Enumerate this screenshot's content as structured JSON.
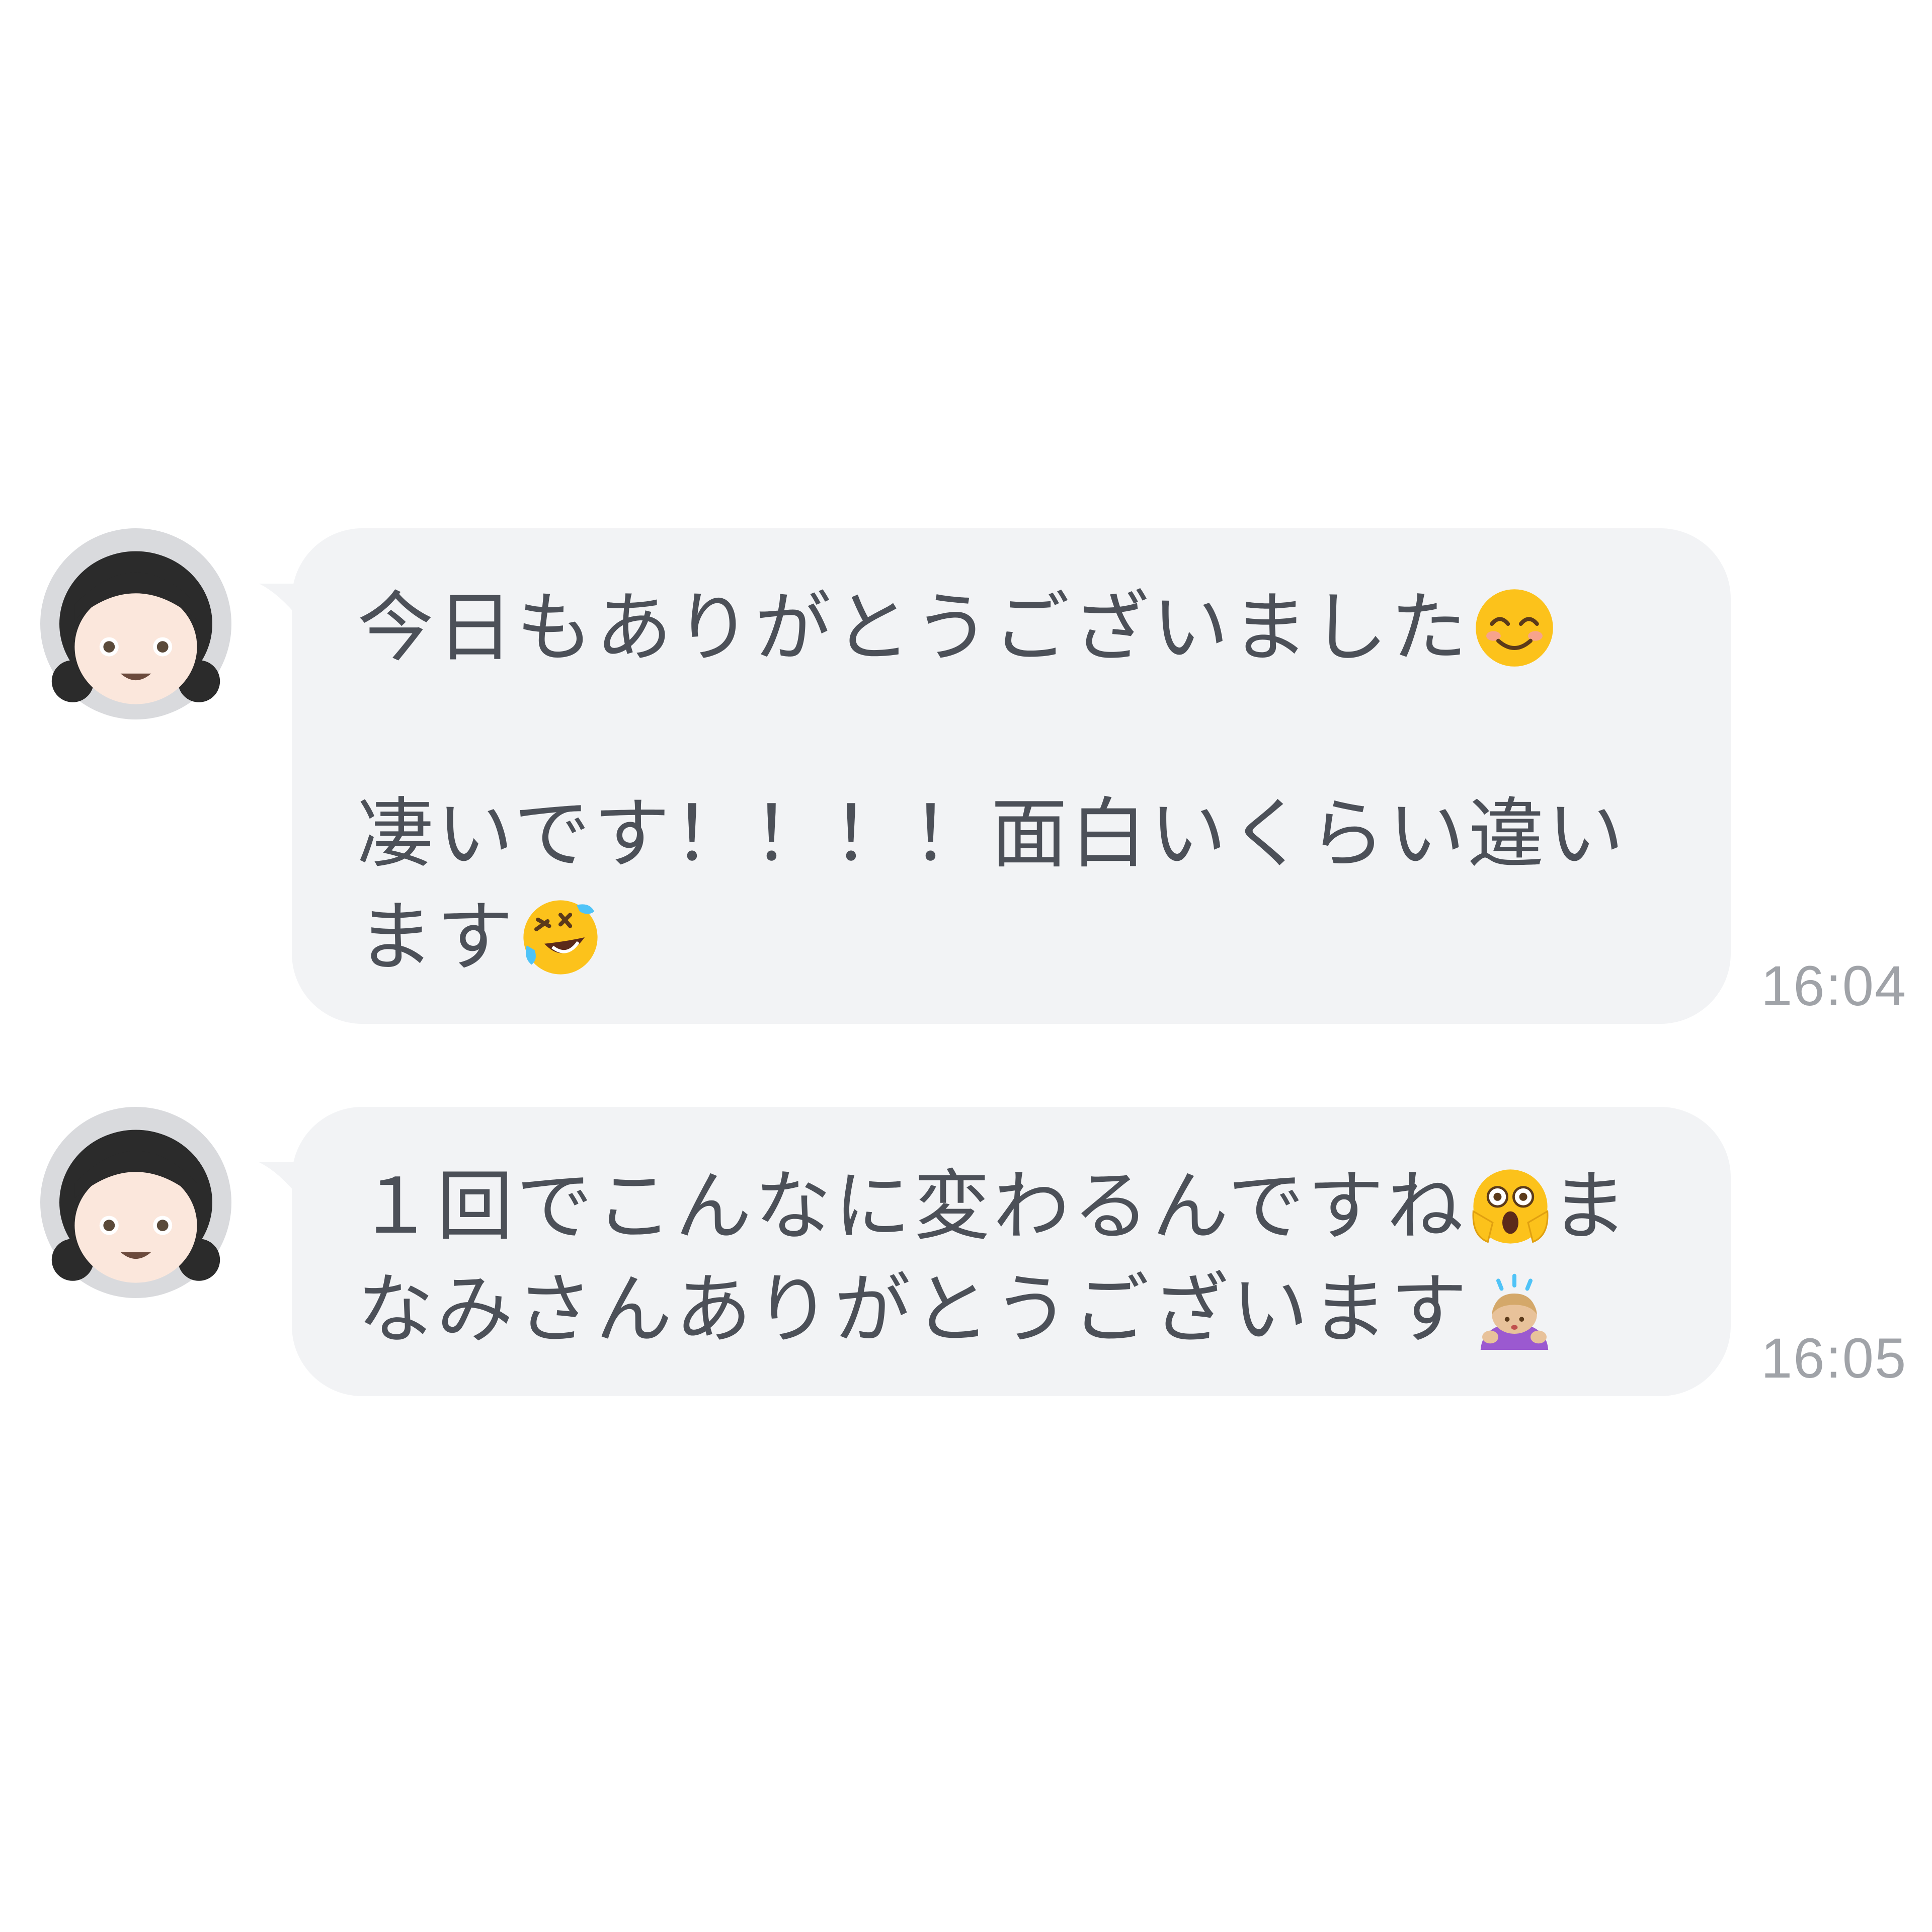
{
  "messages": [
    {
      "avatar_icon": "girl-avatar-icon",
      "line1": "今日もありがとうございました",
      "line1_emoji": "smiling-face-icon",
      "line2": "凄いです！！！！面白いくらい違い",
      "line3": "ます",
      "line3_emoji": "rolling-on-floor-laughing-icon",
      "time": "16:04"
    },
    {
      "avatar_icon": "girl-avatar-icon",
      "line1": "１回でこんなに変わるんですね",
      "line1_emoji": "astonished-face-icon",
      "line1_tail": "ま",
      "line2": "なみさんありがとうございます",
      "line2_emoji": "person-bowing-icon",
      "time": "16:05"
    }
  ],
  "colors": {
    "bubble": "#f2f3f5",
    "text": "#4c5058",
    "timestamp": "#a0a3a8",
    "background": "#ffffff"
  }
}
